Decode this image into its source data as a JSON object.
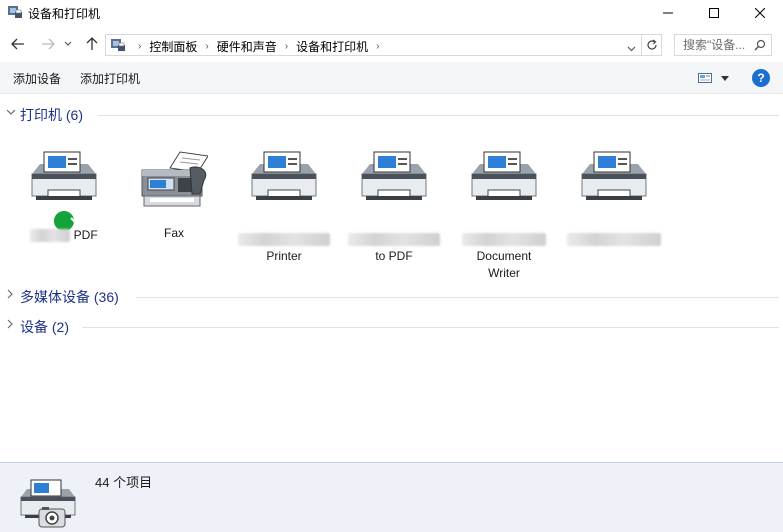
{
  "window": {
    "title": "设备和打印机",
    "min_label": "—",
    "max_label": "☐",
    "close_label": "✕"
  },
  "nav": {
    "breadcrumbs": [
      "控制面板",
      "硬件和声音",
      "设备和打印机"
    ],
    "search_placeholder": "搜索\"设备...",
    "icons": {
      "back": "arrow-left-icon",
      "forward": "arrow-right-icon",
      "recent": "chevron-down-icon",
      "up": "arrow-up-icon",
      "refresh": "refresh-icon",
      "search": "search-icon"
    }
  },
  "toolbar": {
    "add_device": "添加设备",
    "add_printer": "添加打印机",
    "help_label": "?"
  },
  "groups": {
    "printers": {
      "label": "打印机 (6)"
    },
    "multimedia": {
      "label": "多媒体设备 (36)"
    },
    "devices": {
      "label": "设备 (2)"
    }
  },
  "printers": [
    {
      "label": "PDF",
      "icon": "printer-icon",
      "is_default": true
    },
    {
      "label": "Fax",
      "icon": "fax-icon",
      "is_default": false
    },
    {
      "label": "Printer",
      "icon": "printer-icon",
      "is_default": false
    },
    {
      "label": "to PDF",
      "icon": "printer-icon",
      "is_default": false
    },
    {
      "label": "Document Writer",
      "icon": "printer-icon",
      "is_default": false
    },
    {
      "label": "",
      "icon": "printer-icon",
      "is_default": false
    }
  ],
  "status": {
    "item_count": "44 个项目"
  },
  "colors": {
    "group_header": "#1e3287",
    "default_badge": "#14a33a",
    "help": "#1a6fd1",
    "statusbar_bg": "#eef1f7"
  }
}
